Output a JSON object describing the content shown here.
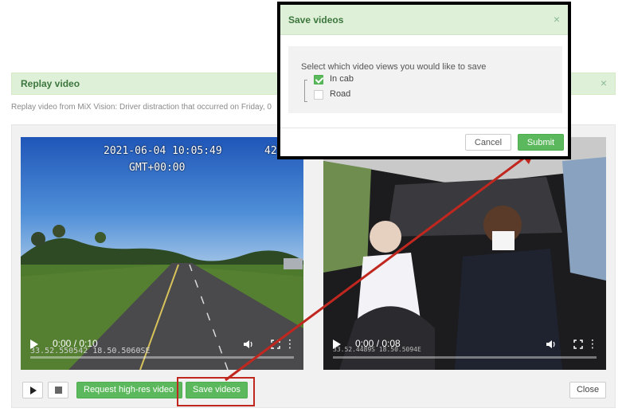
{
  "replay": {
    "title": "Replay video",
    "close_glyph": "×",
    "subtitle": "Replay video from MiX Vision: Driver distraction that occurred on Friday, 0"
  },
  "videos": {
    "road": {
      "date_stamp": "2021-06-04 10:05:49",
      "timezone_stamp": "GMT+00:00",
      "side_number": "42",
      "time": "0:00 / 0:10",
      "gps": "33.52.550542 18.50.5060SE",
      "progress": 0
    },
    "cab": {
      "time": "0:00 / 0:08",
      "gps": "33.52.4489S 18.50.5094E",
      "progress": 0
    }
  },
  "toolbar": {
    "request_label": "Request high-res video",
    "save_label": "Save videos",
    "close_label": "Close"
  },
  "modal": {
    "title": "Save videos",
    "close_glyph": "×",
    "prompt": "Select which video views you would like to save",
    "options": [
      {
        "label": "In cab",
        "checked": true
      },
      {
        "label": "Road",
        "checked": false
      }
    ],
    "cancel_label": "Cancel",
    "submit_label": "Submit"
  },
  "colors": {
    "accent_green": "#5cb85c",
    "header_green_bg": "#dff0d8",
    "header_green_text": "#3c763d",
    "annotation_red": "#c0271f"
  },
  "icons": [
    "play-icon",
    "stop-icon",
    "volume-icon",
    "fullscreen-icon",
    "more-options-icon",
    "close-icon",
    "checkmark-icon"
  ]
}
